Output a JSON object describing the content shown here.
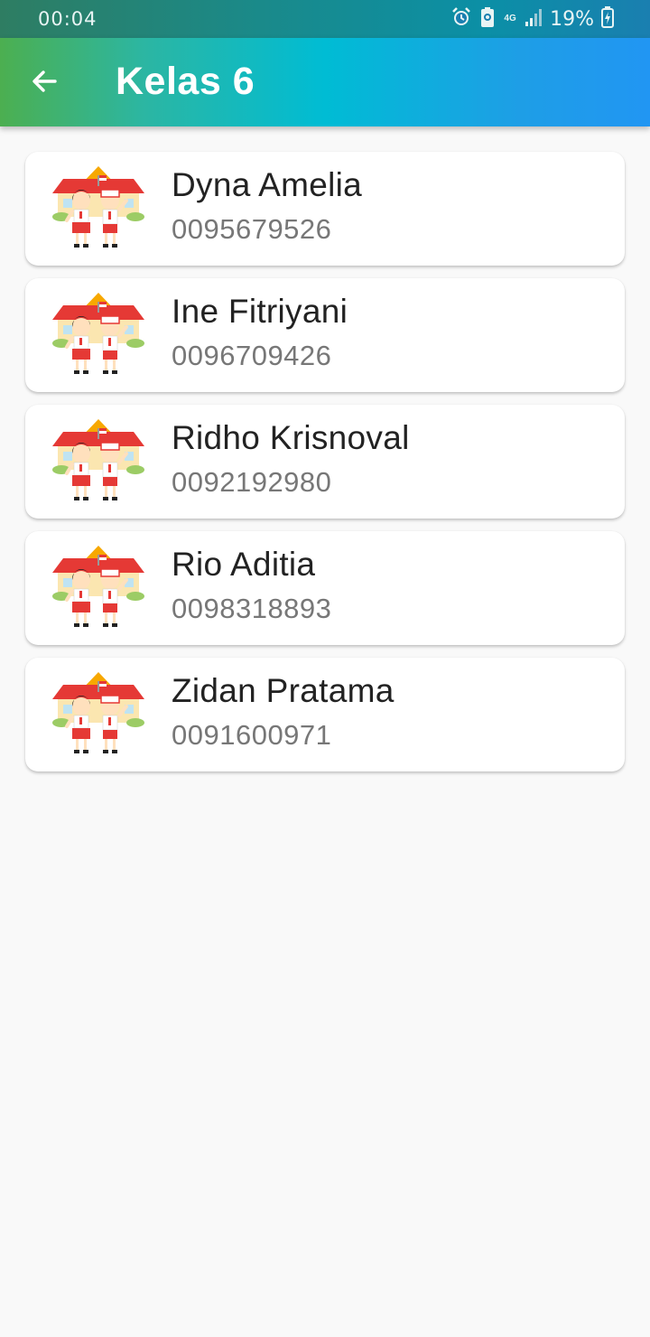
{
  "status_bar": {
    "time": "00:04",
    "network": "4G",
    "battery_percent": "19%",
    "icons": [
      "alarm-icon",
      "battery-saver-icon",
      "network-4g-icon",
      "signal-icon",
      "battery-charging-icon"
    ]
  },
  "app_bar": {
    "back_icon": "arrow-left-icon",
    "title": "Kelas 6"
  },
  "students": [
    {
      "name": "Dyna Amelia",
      "nisn": "0095679526",
      "icon": "school-kids-icon"
    },
    {
      "name": "Ine Fitriyani",
      "nisn": "0096709426",
      "icon": "school-kids-icon"
    },
    {
      "name": "Ridho Krisnoval",
      "nisn": "0092192980",
      "icon": "school-kids-icon"
    },
    {
      "name": "Rio Aditia",
      "nisn": "0098318893",
      "icon": "school-kids-icon"
    },
    {
      "name": "Zidan Pratama",
      "nisn": "0091600971",
      "icon": "school-kids-icon"
    }
  ],
  "colors": {
    "appbar_start": "#4caf50",
    "appbar_mid": "#00bcd4",
    "appbar_end": "#2196f3",
    "background": "#f9f9f9",
    "name_text": "#222222",
    "nisn_text": "#777777"
  }
}
